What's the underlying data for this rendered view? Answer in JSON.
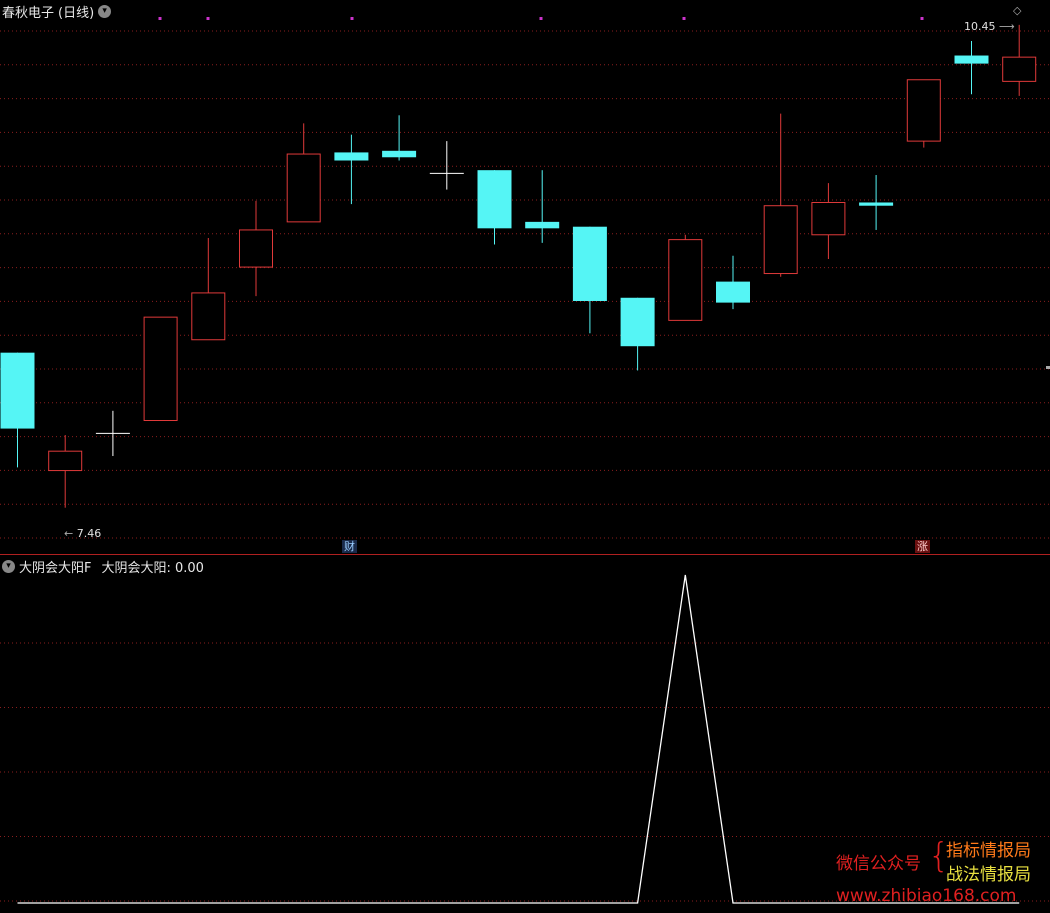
{
  "main": {
    "title": "春秋电子",
    "period": "(日线)",
    "high_label": "10.45",
    "low_label": "7.46",
    "tag_finance": "财",
    "tag_rise": "涨",
    "marker": "◇"
  },
  "indicator": {
    "name": "大阴会大阳F",
    "value_label": "大阴会大阳: 0.00"
  },
  "watermark": {
    "line1": "微信公众号",
    "brace": "{",
    "line2": "指标情报局",
    "line3": "战法情报局",
    "url": "www.zhibiao168.com"
  },
  "colors": {
    "up": "#e03a3a",
    "down": "#55f5f5",
    "flat": "#ffffff",
    "grid": "#8a1e1e",
    "marker": "#cc33cc",
    "indicator_line": "#ffffff"
  },
  "chart_data": {
    "type": "candlestick",
    "candles": [
      {
        "o": 8.42,
        "c": 7.95,
        "h": 8.42,
        "l": 7.71
      },
      {
        "o": 7.69,
        "c": 7.81,
        "h": 7.91,
        "l": 7.46
      },
      {
        "o": 7.92,
        "c": 7.92,
        "h": 8.06,
        "l": 7.78
      },
      {
        "o": 8.0,
        "c": 8.64,
        "h": 8.64,
        "l": 8.0
      },
      {
        "o": 8.5,
        "c": 8.79,
        "h": 9.13,
        "l": 8.5
      },
      {
        "o": 8.95,
        "c": 9.18,
        "h": 9.36,
        "l": 8.77
      },
      {
        "o": 9.23,
        "c": 9.65,
        "h": 9.84,
        "l": 9.23
      },
      {
        "o": 9.66,
        "c": 9.61,
        "h": 9.77,
        "l": 9.34
      },
      {
        "o": 9.67,
        "c": 9.63,
        "h": 9.89,
        "l": 9.61
      },
      {
        "o": 9.53,
        "c": 9.53,
        "h": 9.73,
        "l": 9.43
      },
      {
        "o": 9.55,
        "c": 9.19,
        "h": 9.55,
        "l": 9.09
      },
      {
        "o": 9.23,
        "c": 9.19,
        "h": 9.55,
        "l": 9.1
      },
      {
        "o": 9.2,
        "c": 8.74,
        "h": 9.2,
        "l": 8.54
      },
      {
        "o": 8.76,
        "c": 8.46,
        "h": 8.76,
        "l": 8.31
      },
      {
        "o": 8.62,
        "c": 9.12,
        "h": 9.15,
        "l": 8.62
      },
      {
        "o": 8.86,
        "c": 8.73,
        "h": 9.02,
        "l": 8.69
      },
      {
        "o": 8.91,
        "c": 9.33,
        "h": 9.9,
        "l": 8.89
      },
      {
        "o": 9.15,
        "c": 9.35,
        "h": 9.47,
        "l": 9.0
      },
      {
        "o": 9.35,
        "c": 9.33,
        "h": 9.52,
        "l": 9.18
      },
      {
        "o": 9.73,
        "c": 10.11,
        "h": 10.11,
        "l": 9.69
      },
      {
        "o": 10.26,
        "c": 10.21,
        "h": 10.35,
        "l": 10.02
      },
      {
        "o": 10.1,
        "c": 10.25,
        "h": 10.45,
        "l": 10.01
      }
    ],
    "ylim": [
      7.26,
      10.48
    ],
    "indicator_values": [
      0,
      0,
      0,
      0,
      0,
      0,
      0,
      0,
      0,
      0,
      0,
      0,
      0,
      0,
      1,
      0,
      0,
      0,
      0,
      0,
      0,
      0
    ],
    "indicator_ylim": [
      0,
      1
    ],
    "grid": true
  }
}
